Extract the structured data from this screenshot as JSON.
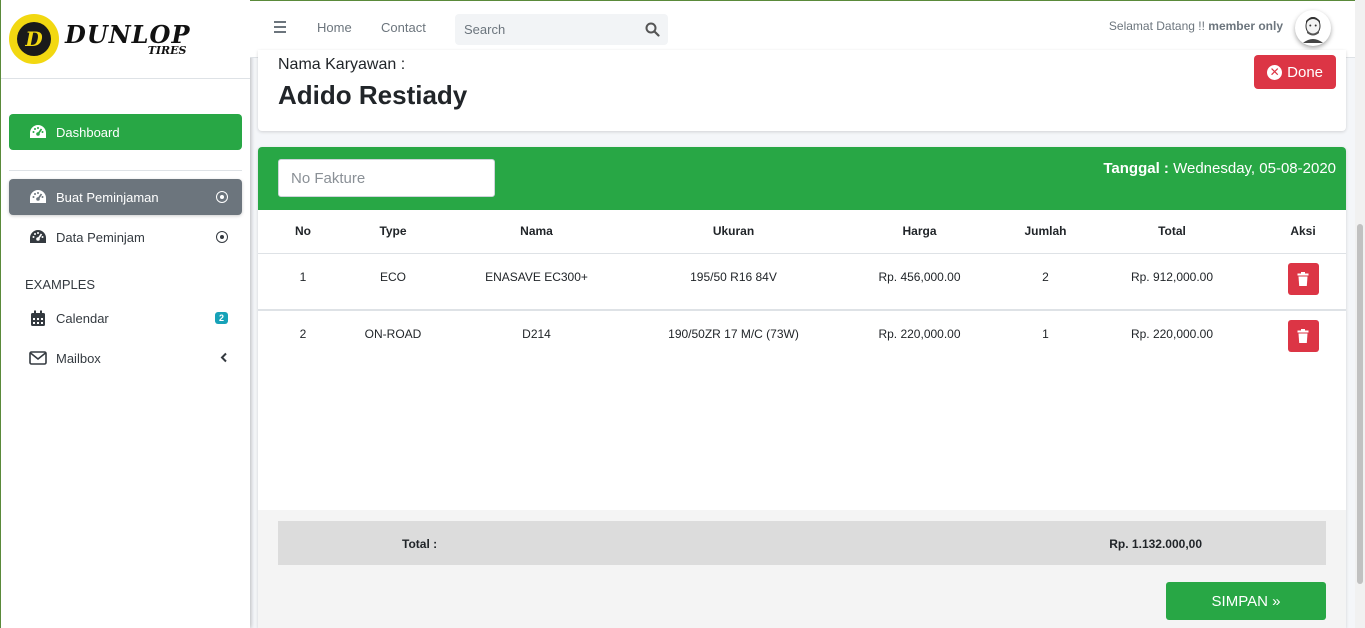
{
  "brand": {
    "main": "DUNLOP",
    "sub": "TIRES",
    "logo_letter": "D"
  },
  "sidebar": {
    "items": [
      {
        "label": "Dashboard",
        "icon": "tachometer-icon"
      },
      {
        "label": "Buat Peminjaman",
        "icon": "tachometer-icon"
      },
      {
        "label": "Data Peminjam",
        "icon": "tachometer-icon"
      }
    ],
    "section_header": "EXAMPLES",
    "examples": [
      {
        "label": "Calendar",
        "icon": "calendar-icon",
        "badge": "2"
      },
      {
        "label": "Mailbox",
        "icon": "envelope-icon"
      }
    ]
  },
  "topbar": {
    "links": [
      "Home",
      "Contact"
    ],
    "search_placeholder": "Search",
    "welcome_prefix": "Selamat Datang !!",
    "welcome_user": "member only"
  },
  "employee": {
    "label": "Nama Karyawan :",
    "name": "Adido Restiady",
    "done_label": "Done"
  },
  "form": {
    "faktur_placeholder": "No Fakture",
    "tanggal_label": "Tanggal :",
    "tanggal_value": "Wednesday, 05-08-2020"
  },
  "table": {
    "headers": [
      "No",
      "Type",
      "Nama",
      "Ukuran",
      "Harga",
      "Jumlah",
      "Total",
      "Aksi"
    ],
    "rows": [
      {
        "no": "1",
        "type": "ECO",
        "nama": "ENASAVE EC300+",
        "ukuran": "195/50 R16 84V",
        "harga": "Rp. 456,000.00",
        "jumlah": "2",
        "total": "Rp. 912,000.00"
      },
      {
        "no": "2",
        "type": "ON-ROAD",
        "nama": "D214",
        "ukuran": "190/50ZR 17 M/C (73W)",
        "harga": "Rp. 220,000.00",
        "jumlah": "1",
        "total": "Rp. 220,000.00"
      }
    ]
  },
  "summary": {
    "total_label": "Total :",
    "total_value": "Rp. 1.132.000,00",
    "save_label": "SIMPAN »"
  },
  "colors": {
    "accent_green": "#28a745",
    "danger_red": "#dc3545",
    "badge_teal": "#17a2b8",
    "brand_yellow": "#f2d811"
  }
}
